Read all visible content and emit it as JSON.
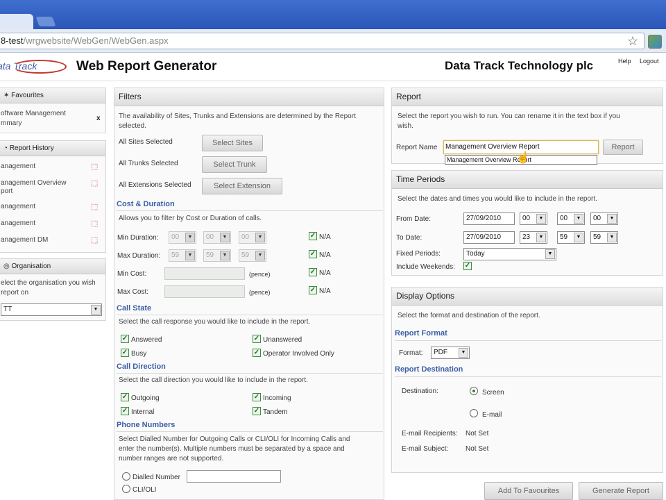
{
  "browser": {
    "url_host": "8-test",
    "url_path": "/wrgwebsite/WebGen/WebGen.aspx"
  },
  "header": {
    "logo_text": "ata Track",
    "title": "Web Report Generator",
    "company": "Data Track Technology plc",
    "help": "Help",
    "logout": "Logout"
  },
  "sidebar": {
    "favourites": {
      "title": "Favourites",
      "item_line1": "oftware Management",
      "item_line2": "mmary",
      "remove": "x"
    },
    "history": {
      "title": "Report History",
      "items": [
        {
          "line1": "anagement",
          "line2": ""
        },
        {
          "line1": "anagement Overview",
          "line2": "port"
        },
        {
          "line1": "anagement",
          "line2": ""
        },
        {
          "line1": "anagement",
          "line2": ""
        },
        {
          "line1": "anagement DM",
          "line2": ""
        }
      ]
    },
    "organisation": {
      "title": "Organisation",
      "desc_line1": "elect the organisation you wish",
      "desc_line2": "report on",
      "value": "TT"
    }
  },
  "filters": {
    "title": "Filters",
    "intro_line1": "The availability of Sites, Trunks and Extensions are determined by the Report",
    "intro_line2": "selected.",
    "sites_label": "All Sites Selected",
    "sites_button": "Select Sites",
    "trunks_label": "All Trunks Selected",
    "trunks_button": "Select Trunk",
    "ext_label": "All Extensions Selected",
    "ext_button": "Select Extension",
    "cost_duration": {
      "title": "Cost & Duration",
      "desc": "Allows you to filter by Cost or Duration of calls.",
      "min_duration": "Min Duration:",
      "max_duration": "Max Duration:",
      "min_vals": [
        "00",
        "00",
        "00"
      ],
      "max_vals": [
        "59",
        "59",
        "59"
      ],
      "min_cost": "Min Cost:",
      "max_cost": "Max Cost:",
      "pence": "(pence)",
      "na": "N/A"
    },
    "call_state": {
      "title": "Call State",
      "desc": "Select the call response you would like to include in the report.",
      "answered": "Answered",
      "unanswered": "Unanswered",
      "busy": "Busy",
      "operator": "Operator Involved Only"
    },
    "call_direction": {
      "title": "Call Direction",
      "desc": "Select the call direction you would like to include in the report.",
      "outgoing": "Outgoing",
      "incoming": "Incoming",
      "internal": "Internal",
      "tandem": "Tandem"
    },
    "phone_numbers": {
      "title": "Phone Numbers",
      "desc_line1": "Select Dialled Number for Outgoing Calls or CLI/OLI for Incoming Calls and",
      "desc_line2": "enter the number(s). Multiple numbers must be separated by a space and",
      "desc_line3": "number ranges are not supported.",
      "dialled": "Dialled Number",
      "cli": "CLI/OLI"
    }
  },
  "report": {
    "title": "Report",
    "desc_line1": "Select the report you wish to run. You can rename it in the text box if you",
    "desc_line2": "wish.",
    "name_label": "Report Name",
    "name_value": "Management Overview Report",
    "suggestion": "Management Overview Report",
    "button": "Report"
  },
  "time_periods": {
    "title": "Time Periods",
    "desc": "Select the dates and times you would like to include in the report.",
    "from_label": "From Date:",
    "from_date": "27/09/2010",
    "from_h": "00",
    "from_m": "00",
    "from_s": "00",
    "to_label": "To Date:",
    "to_date": "27/09/2010",
    "to_h": "23",
    "to_m": "59",
    "to_s": "59",
    "fixed_label": "Fixed Periods:",
    "fixed_value": "Today",
    "weekends_label": "Include Weekends:"
  },
  "display_options": {
    "title": "Display Options",
    "desc": "Select the format and destination of the report.",
    "format_title": "Report Format",
    "format_label": "Format:",
    "format_value": "PDF",
    "dest_title": "Report Destination",
    "dest_label": "Destination:",
    "screen": "Screen",
    "email": "E-mail",
    "recipients_label": "E-mail Recipients:",
    "recipients_value": "Not Set",
    "subject_label": "E-mail Subject:",
    "subject_value": "Not Set"
  },
  "actions": {
    "add_favourites": "Add To Favourites",
    "generate": "Generate Report"
  }
}
